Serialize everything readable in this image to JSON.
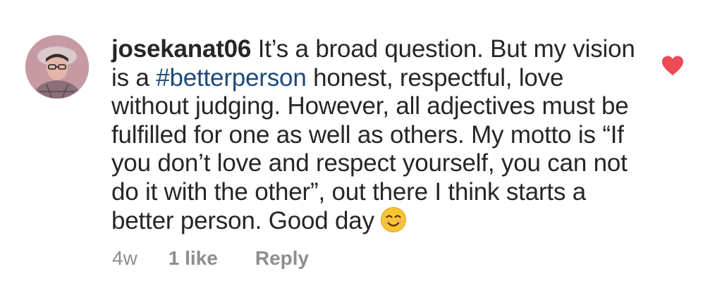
{
  "comment": {
    "username": "josekanat06",
    "text_before_hashtag": " It’s a broad question. But my vision is a ",
    "hashtag": "#betterperson",
    "text_after_hashtag": " honest, respectful, love without judging. However, all adjectives must be fulfilled for one as well as others. My motto is “If you don’t love and respect yourself, you can not do it with the other”, out there I think starts a better person. Good day",
    "emoji": "smiling-face-icon",
    "liked": true,
    "like_color": "#ed4956",
    "hashtag_color": "#1d4a7b"
  },
  "meta": {
    "age": "4w",
    "likes": "1 like",
    "reply": "Reply"
  }
}
